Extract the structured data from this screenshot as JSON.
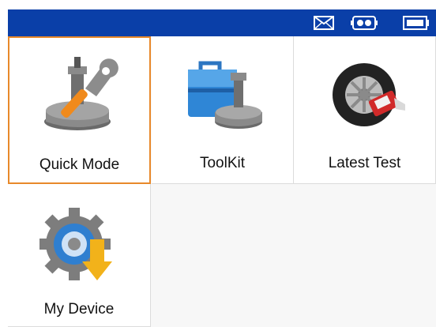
{
  "status_bar": {
    "icons": [
      "mail-icon",
      "vehicle-link-icon",
      "battery-icon"
    ],
    "color": "#0a3fa8"
  },
  "menu": {
    "selected_color": "#e8892a",
    "items": [
      {
        "label": "Quick Mode",
        "icon": "quick-mode-icon",
        "selected": true
      },
      {
        "label": "ToolKit",
        "icon": "toolkit-icon",
        "selected": false
      },
      {
        "label": "Latest Test",
        "icon": "latest-test-icon",
        "selected": false
      },
      {
        "label": "My Device",
        "icon": "my-device-icon",
        "selected": false
      }
    ]
  }
}
